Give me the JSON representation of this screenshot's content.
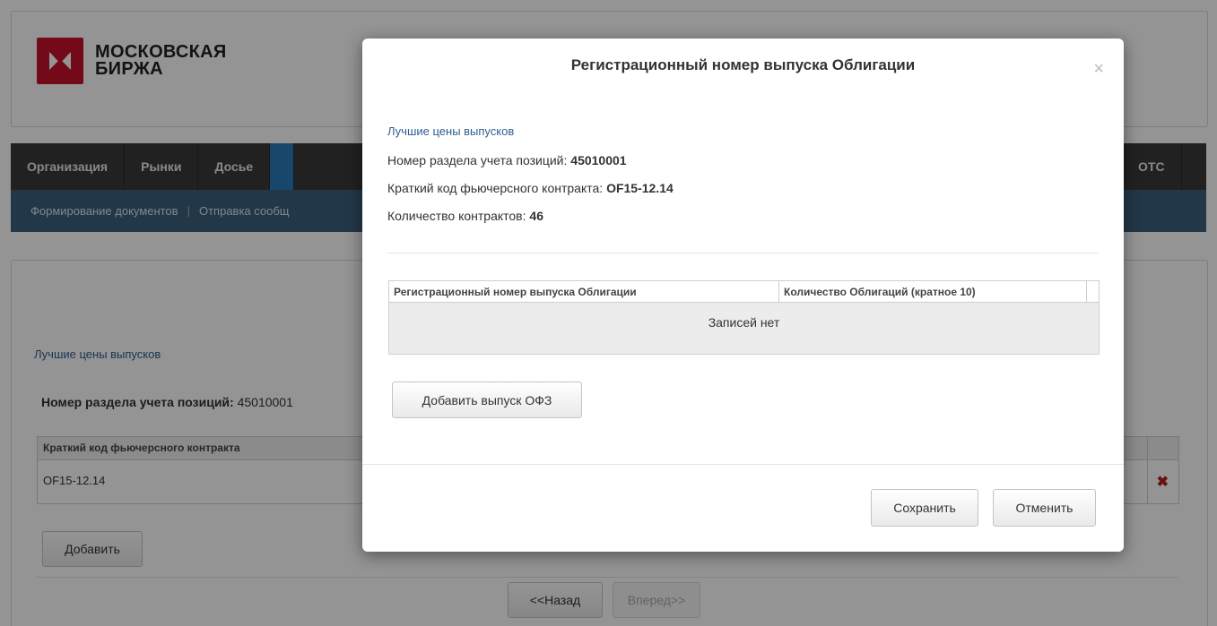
{
  "brand": {
    "line1": "МОСКОВСКАЯ",
    "line2": "БИРЖА"
  },
  "nav": {
    "items": [
      "Организация",
      "Рынки",
      "Досье"
    ],
    "otc": "OTC"
  },
  "subnav": {
    "items": [
      "Формирование документов",
      "Отправка сообщ"
    ]
  },
  "background": {
    "link": "Лучшие цены выпусков",
    "position_label": "Номер раздела учета позиций:",
    "position_value": "45010001",
    "table_header": "Краткий код фьючерсного контракта",
    "table_value": "OF15-12.14",
    "add_button": "Добавить",
    "back_button": "<<Назад",
    "forward_button": "Вперед>>"
  },
  "modal": {
    "title": "Регистрационный номер выпуска Облигации",
    "link": "Лучшие цены выпусков",
    "position_label": "Номер раздела учета позиций:",
    "position_value": "45010001",
    "contract_label": "Краткий код фьючерсного контракта:",
    "contract_value": "OF15-12.14",
    "count_label": "Количество контрактов:",
    "count_value": "46",
    "table": {
      "columns": [
        "Регистрационный номер выпуска Облигации",
        "Количество Облигаций (кратное 10)"
      ],
      "empty_text": "Записей нет"
    },
    "add_ofz_button": "Добавить выпуск ОФЗ",
    "save_button": "Сохранить",
    "cancel_button": "Отменить"
  }
}
